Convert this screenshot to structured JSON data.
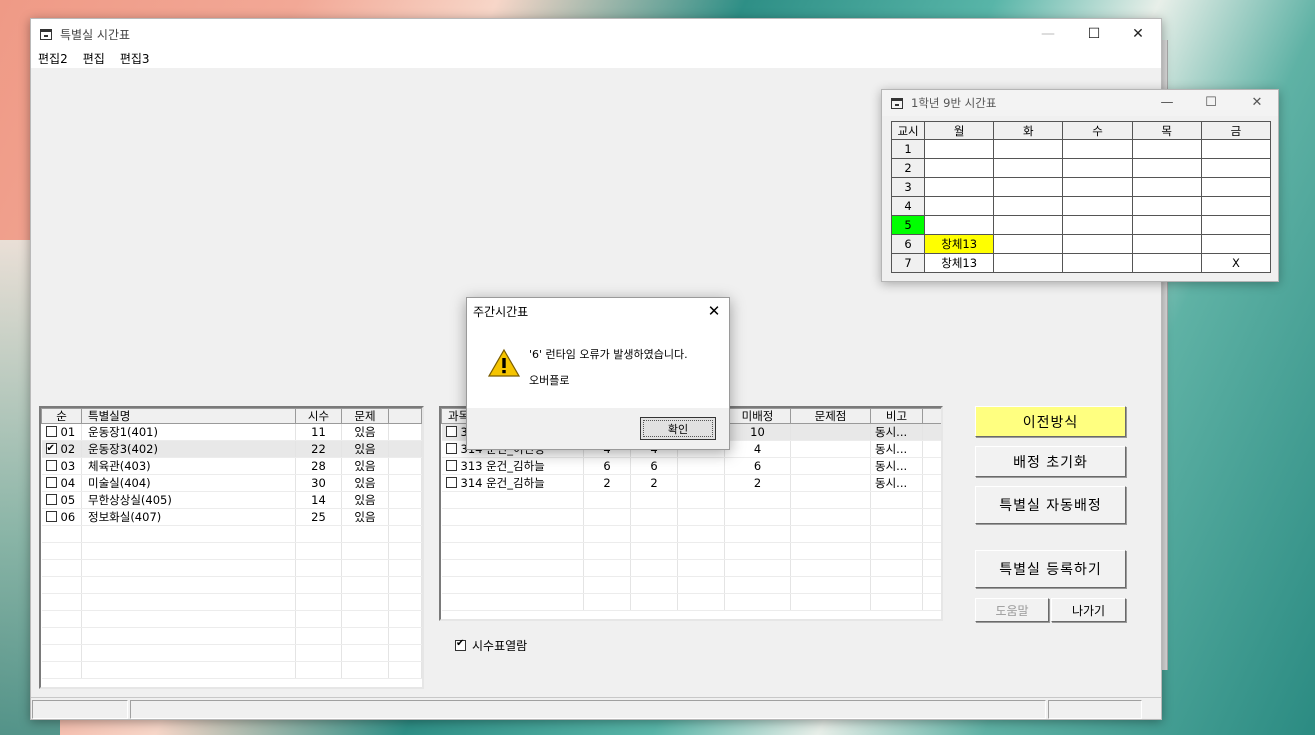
{
  "main_window": {
    "title": "특별실 시간표",
    "controls": {
      "minimize": "—",
      "maximize": "☐",
      "close": "✕"
    },
    "menu": [
      "편집2",
      "편집",
      "편집3"
    ]
  },
  "rooms_table": {
    "headers": [
      "순",
      "특별실명",
      "시수",
      "문제"
    ],
    "rows": [
      {
        "checked": false,
        "no": "01",
        "name": "운동장1(401)",
        "hours": "11",
        "issue": "있음"
      },
      {
        "checked": true,
        "no": "02",
        "name": "운동장3(402)",
        "hours": "22",
        "issue": "있음"
      },
      {
        "checked": false,
        "no": "03",
        "name": "체육관(403)",
        "hours": "28",
        "issue": "있음"
      },
      {
        "checked": false,
        "no": "04",
        "name": "미술실(404)",
        "hours": "30",
        "issue": "있음"
      },
      {
        "checked": false,
        "no": "05",
        "name": "무한상상실(405)",
        "hours": "14",
        "issue": "있음"
      },
      {
        "checked": false,
        "no": "06",
        "name": "정보화실(407)",
        "hours": "25",
        "issue": "있음"
      }
    ]
  },
  "subjects_table": {
    "headers": [
      "과목",
      "",
      "",
      "",
      "미배정",
      "문제점",
      "비고"
    ],
    "rows": [
      {
        "subject": "3",
        "a": "",
        "b": "",
        "c": "",
        "unassigned": "10",
        "issue": "",
        "note": "동시..."
      },
      {
        "subject": "314 운건_이민정",
        "a": "4",
        "b": "4",
        "c": "",
        "unassigned": "4",
        "issue": "",
        "note": "동시..."
      },
      {
        "subject": "313 운건_김하늘",
        "a": "6",
        "b": "6",
        "c": "",
        "unassigned": "6",
        "issue": "",
        "note": "동시..."
      },
      {
        "subject": "314 운건_김하늘",
        "a": "2",
        "b": "2",
        "c": "",
        "unassigned": "2",
        "issue": "",
        "note": "동시..."
      }
    ]
  },
  "buttons": {
    "prev_method": "이전방식",
    "reset": "배정 초기화",
    "auto_assign": "특별실 자동배정",
    "register": "특별실 등록하기",
    "help": "도움말",
    "exit": "나가기"
  },
  "show_hours_checkbox": {
    "label": "시수표열람",
    "checked": true
  },
  "sub_window": {
    "title": "1학년 9반 시간표",
    "headers": [
      "교시",
      "월",
      "화",
      "수",
      "목",
      "금"
    ],
    "rows": [
      {
        "period": "1",
        "cells": [
          "",
          "",
          "",
          "",
          ""
        ]
      },
      {
        "period": "2",
        "cells": [
          "",
          "",
          "",
          "",
          ""
        ]
      },
      {
        "period": "3",
        "cells": [
          "",
          "",
          "",
          "",
          ""
        ]
      },
      {
        "period": "4",
        "cells": [
          "",
          "",
          "",
          "",
          ""
        ]
      },
      {
        "period": "5",
        "cells": [
          "",
          "",
          "",
          "",
          ""
        ]
      },
      {
        "period": "6",
        "cells": [
          "창체13",
          "",
          "",
          "",
          ""
        ]
      },
      {
        "period": "7",
        "cells": [
          "창체13",
          "",
          "",
          "",
          "X"
        ]
      }
    ],
    "highlight_period_color": "#00ff00",
    "highlight_cell_color": "#ffff00"
  },
  "dialog": {
    "title": "주간시간표",
    "message": "'6' 런타임 오류가 발생하였습니다.",
    "detail": "오버플로",
    "ok": "확인"
  },
  "colors": {
    "accent_yellow": "#ffff80"
  }
}
